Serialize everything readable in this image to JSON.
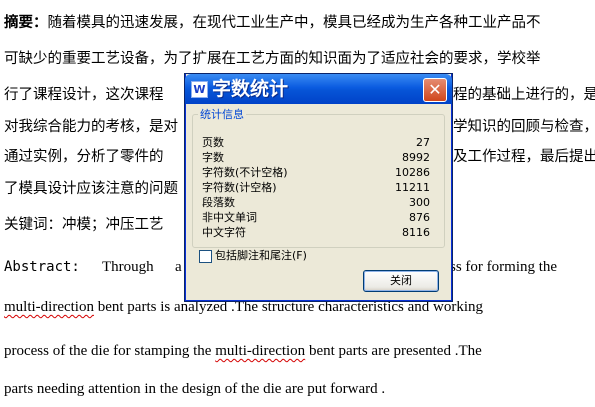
{
  "document": {
    "abstract_label": "摘要：",
    "line1_rest": "随着模具的迅速发展，在现代工业生产中，模具已经成为生产各种工业产品不",
    "line2": "可缺少的重要工艺设备，为了扩展在工艺方面的知识面为了适应社会的要求，学校举",
    "line3_left": "行了课程设计，这次课程",
    "line3_right": "程的基础上进行的，是",
    "line4_left": "对我综合能力的考核，是对",
    "line4_right": "学知识的回顾与检查，",
    "line5_left": "通过实例，分析了零件的",
    "line5_right": "及工作过程，最后提出",
    "line6_left": "了模具设计应该注意的问题",
    "keywords_left": "关键词：冲模；冲压工艺",
    "abstract_en_label": "Abstract:",
    "abstract_en_word": "Through",
    "abstract_en_a": "a",
    "abstract_en_right": "ss for forming the",
    "en_line2_a": "multi-direction",
    "en_line2_b": " bent parts is analyzed .The structure characteristics and working",
    "en_line3_a": "process of the die for stamping the ",
    "en_line3_b": "multi-direction",
    "en_line3_c": " bent parts are presented .The",
    "en_line4": "parts needing attention in the design of the die are put forward ."
  },
  "dialog": {
    "title": "字数统计",
    "app_icon": "word-doc-icon",
    "close_glyph": "✕",
    "group_label": "统计信息",
    "stats": [
      {
        "label": "页数",
        "value": "27"
      },
      {
        "label": "字数",
        "value": "8992"
      },
      {
        "label": "字符数(不计空格)",
        "value": "10286"
      },
      {
        "label": "字符数(计空格)",
        "value": "11211"
      },
      {
        "label": "段落数",
        "value": "300"
      },
      {
        "label": "非中文单词",
        "value": "876"
      },
      {
        "label": "中文字符",
        "value": "8116"
      }
    ],
    "checkbox_label": "包括脚注和尾注(F)",
    "checkbox_checked": false,
    "close_button_label": "关闭"
  }
}
